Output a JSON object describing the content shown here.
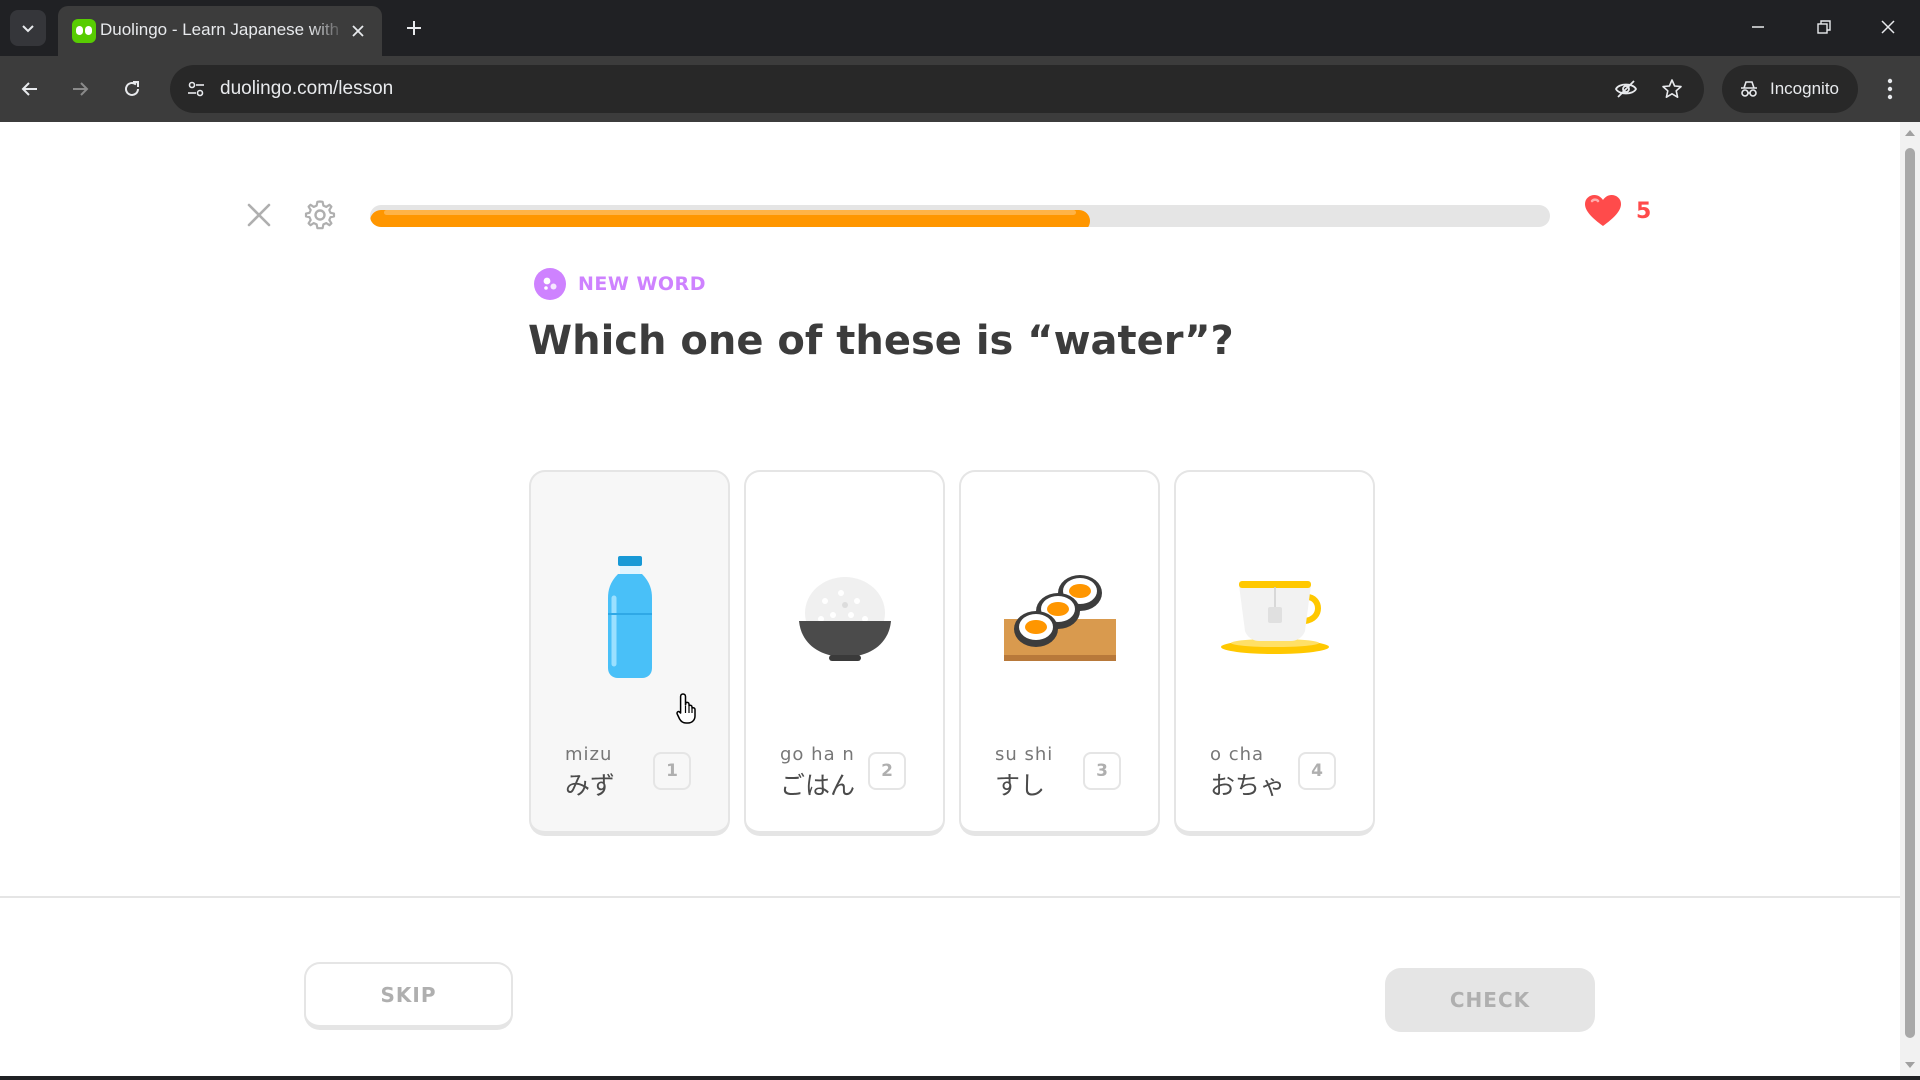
{
  "browser": {
    "tab_title": "Duolingo - Learn Japanese with",
    "url": "duolingo.com/lesson",
    "incognito_label": "Incognito"
  },
  "lesson": {
    "progress_fraction": 0.61,
    "hearts": "5",
    "badge": "NEW WORD",
    "question": "Which one of these is “water”?",
    "choices": [
      {
        "romaji": "mizu",
        "kana": "みず",
        "key": "1",
        "icon": "water-bottle"
      },
      {
        "romaji": "go ha n",
        "kana": "ごはん",
        "key": "2",
        "icon": "rice-bowl"
      },
      {
        "romaji": "su shi",
        "kana": "すし",
        "key": "3",
        "icon": "sushi"
      },
      {
        "romaji": "o  cha",
        "kana": "おちゃ",
        "key": "4",
        "icon": "tea-cup"
      }
    ],
    "skip_label": "SKIP",
    "check_label": "CHECK"
  },
  "colors": {
    "progress": "#ff9600",
    "heart": "#ff4b4b",
    "badge": "#ce82ff"
  }
}
